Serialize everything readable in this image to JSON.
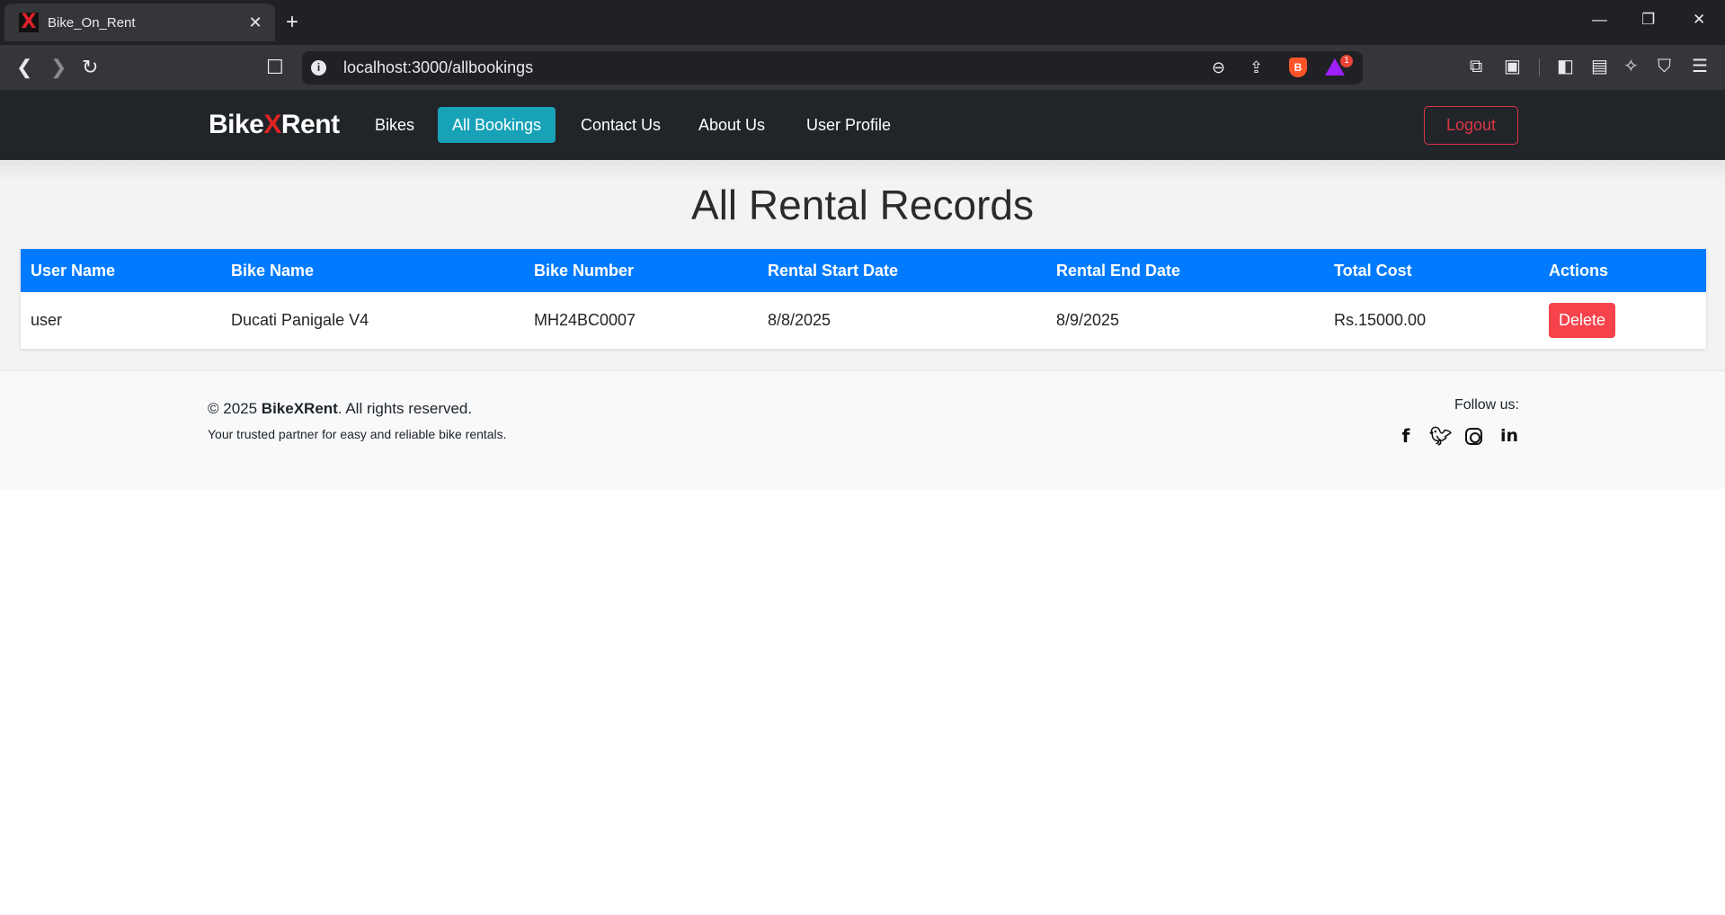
{
  "browser": {
    "tab_title": "Bike_On_Rent",
    "favicon_letter": "X",
    "url": "localhost:3000/allbookings",
    "rewards_badge": "1"
  },
  "navbar": {
    "brand_part1": "Bike",
    "brand_x": "X",
    "brand_part2": "Rent",
    "links": [
      "Bikes",
      "All Bookings",
      "Contact Us",
      "About Us",
      "User Profile"
    ],
    "active_link": "All Bookings",
    "logout_label": "Logout"
  },
  "main": {
    "title": "All Rental Records",
    "columns": [
      "User Name",
      "Bike Name",
      "Bike Number",
      "Rental Start Date",
      "Rental End Date",
      "Total Cost",
      "Actions"
    ],
    "rows": [
      {
        "user_name": "user",
        "bike_name": "Ducati Panigale V4",
        "bike_number": "MH24BC0007",
        "start_date": "8/8/2025",
        "end_date": "8/9/2025",
        "total_cost": "Rs.15000.00",
        "action_label": "Delete"
      }
    ]
  },
  "footer": {
    "copyright_prefix": "© 2025 ",
    "copyright_brand": "BikeXRent",
    "copyright_suffix": ". All rights reserved.",
    "tagline": "Your trusted partner for easy and reliable bike rentals.",
    "follow_label": "Follow us:",
    "social_icons": [
      "facebook-icon",
      "twitter-icon",
      "instagram-icon",
      "linkedin-icon"
    ]
  },
  "colors": {
    "nav_bg": "#212529",
    "active_link_bg": "#17a2b8",
    "table_header_bg": "#007bff",
    "delete_bg": "#f5424b",
    "logout": "#dc3545",
    "brand_x": "#e02424"
  }
}
